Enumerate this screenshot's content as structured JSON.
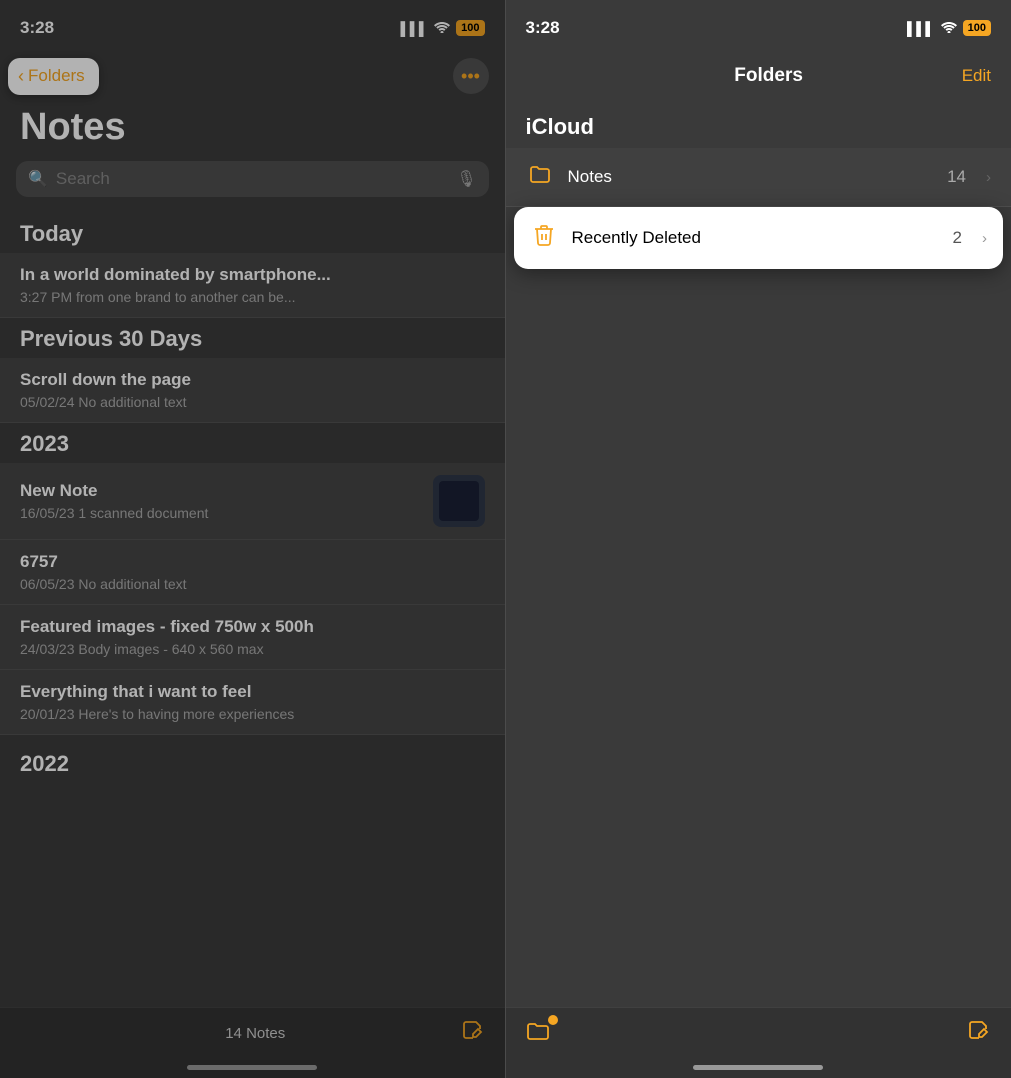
{
  "left": {
    "status": {
      "time": "3:28",
      "signal": "▌▌▌",
      "wifi": "WiFi",
      "battery": "100"
    },
    "back_button_label": "Folders",
    "title": "Notes",
    "search_placeholder": "Search",
    "sections": [
      {
        "header": "Today",
        "notes": [
          {
            "title": "In a world dominated by smartphone...",
            "meta": "3:27 PM  from one brand to another can be..."
          }
        ]
      },
      {
        "header": "Previous 30 Days",
        "notes": [
          {
            "title": "Scroll down the page",
            "meta": "05/02/24  No additional text"
          }
        ]
      },
      {
        "header": "2023",
        "notes": [
          {
            "title": "New Note",
            "meta": "16/05/23  1 scanned document",
            "has_thumb": true
          },
          {
            "title": "6757",
            "meta": "06/05/23  No additional text"
          },
          {
            "title": "Featured images - fixed 750w x 500h",
            "meta": "24/03/23  Body images - 640 x 560 max"
          },
          {
            "title": "Everything that i want to feel",
            "meta": "20/01/23  Here's to having more experiences"
          }
        ]
      },
      {
        "header": "2022",
        "notes": []
      }
    ],
    "bottom": {
      "notes_count": "14 Notes",
      "compose_symbol": "⎙"
    }
  },
  "right": {
    "status": {
      "time": "3:28",
      "signal": "▌▌▌",
      "wifi": "WiFi",
      "battery": "100"
    },
    "nav": {
      "title": "Folders",
      "edit_label": "Edit"
    },
    "section_label": "iCloud",
    "folders": [
      {
        "icon_type": "folder",
        "label": "Notes",
        "count": "14",
        "highlighted": false
      },
      {
        "icon_type": "trash",
        "label": "Recently Deleted",
        "count": "2",
        "highlighted": true
      }
    ],
    "bottom": {
      "compose_symbol": "⎙"
    }
  }
}
